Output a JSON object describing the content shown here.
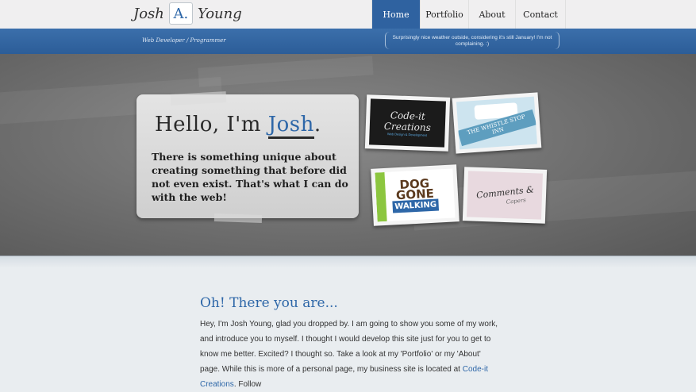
{
  "header": {
    "logo_first": "Josh",
    "logo_initial": "A.",
    "logo_last": "Young",
    "nav": [
      {
        "label": "Home",
        "active": true
      },
      {
        "label": "Portfolio",
        "active": false
      },
      {
        "label": "About",
        "active": false
      },
      {
        "label": "Contact",
        "active": false
      }
    ],
    "tagline": "Web Developer / Programmer",
    "weather": "Surprisingly nice weather outside, considering it's still January! I'm not complaining. :)"
  },
  "hero": {
    "greeting": "Hello, I'm ",
    "name": "Josh",
    "period": ".",
    "intro": "There is something unique about creating something that before did not even exist. That's what I can do with the web!",
    "portfolio": [
      {
        "title": "Code-it Creations",
        "subtitle": "Web Design & Development"
      },
      {
        "title": "THE WHISTLE STOP INN"
      },
      {
        "title_line1": "DOG",
        "title_line2": "GONE",
        "title_line3": "WALKING"
      },
      {
        "title": "Comments &",
        "subtitle": "Capers"
      }
    ]
  },
  "content": {
    "heading": "Oh! There you are...",
    "paragraph": "Hey, I'm Josh Young, glad you dropped by. I am going to show you some of my work, and introduce you to myself. I thought I would develop this site just for you to get to know me better. Excited? I thought so. Take a look at my 'Portfolio' or my 'About' page. While this is more of a personal page, my business site is located at",
    "link": "Code-it Creations",
    "trailing": ". Follow"
  },
  "colors": {
    "accent": "#2e67a8",
    "nav_active": "#2f62a0",
    "subbar": "#3467a3"
  }
}
